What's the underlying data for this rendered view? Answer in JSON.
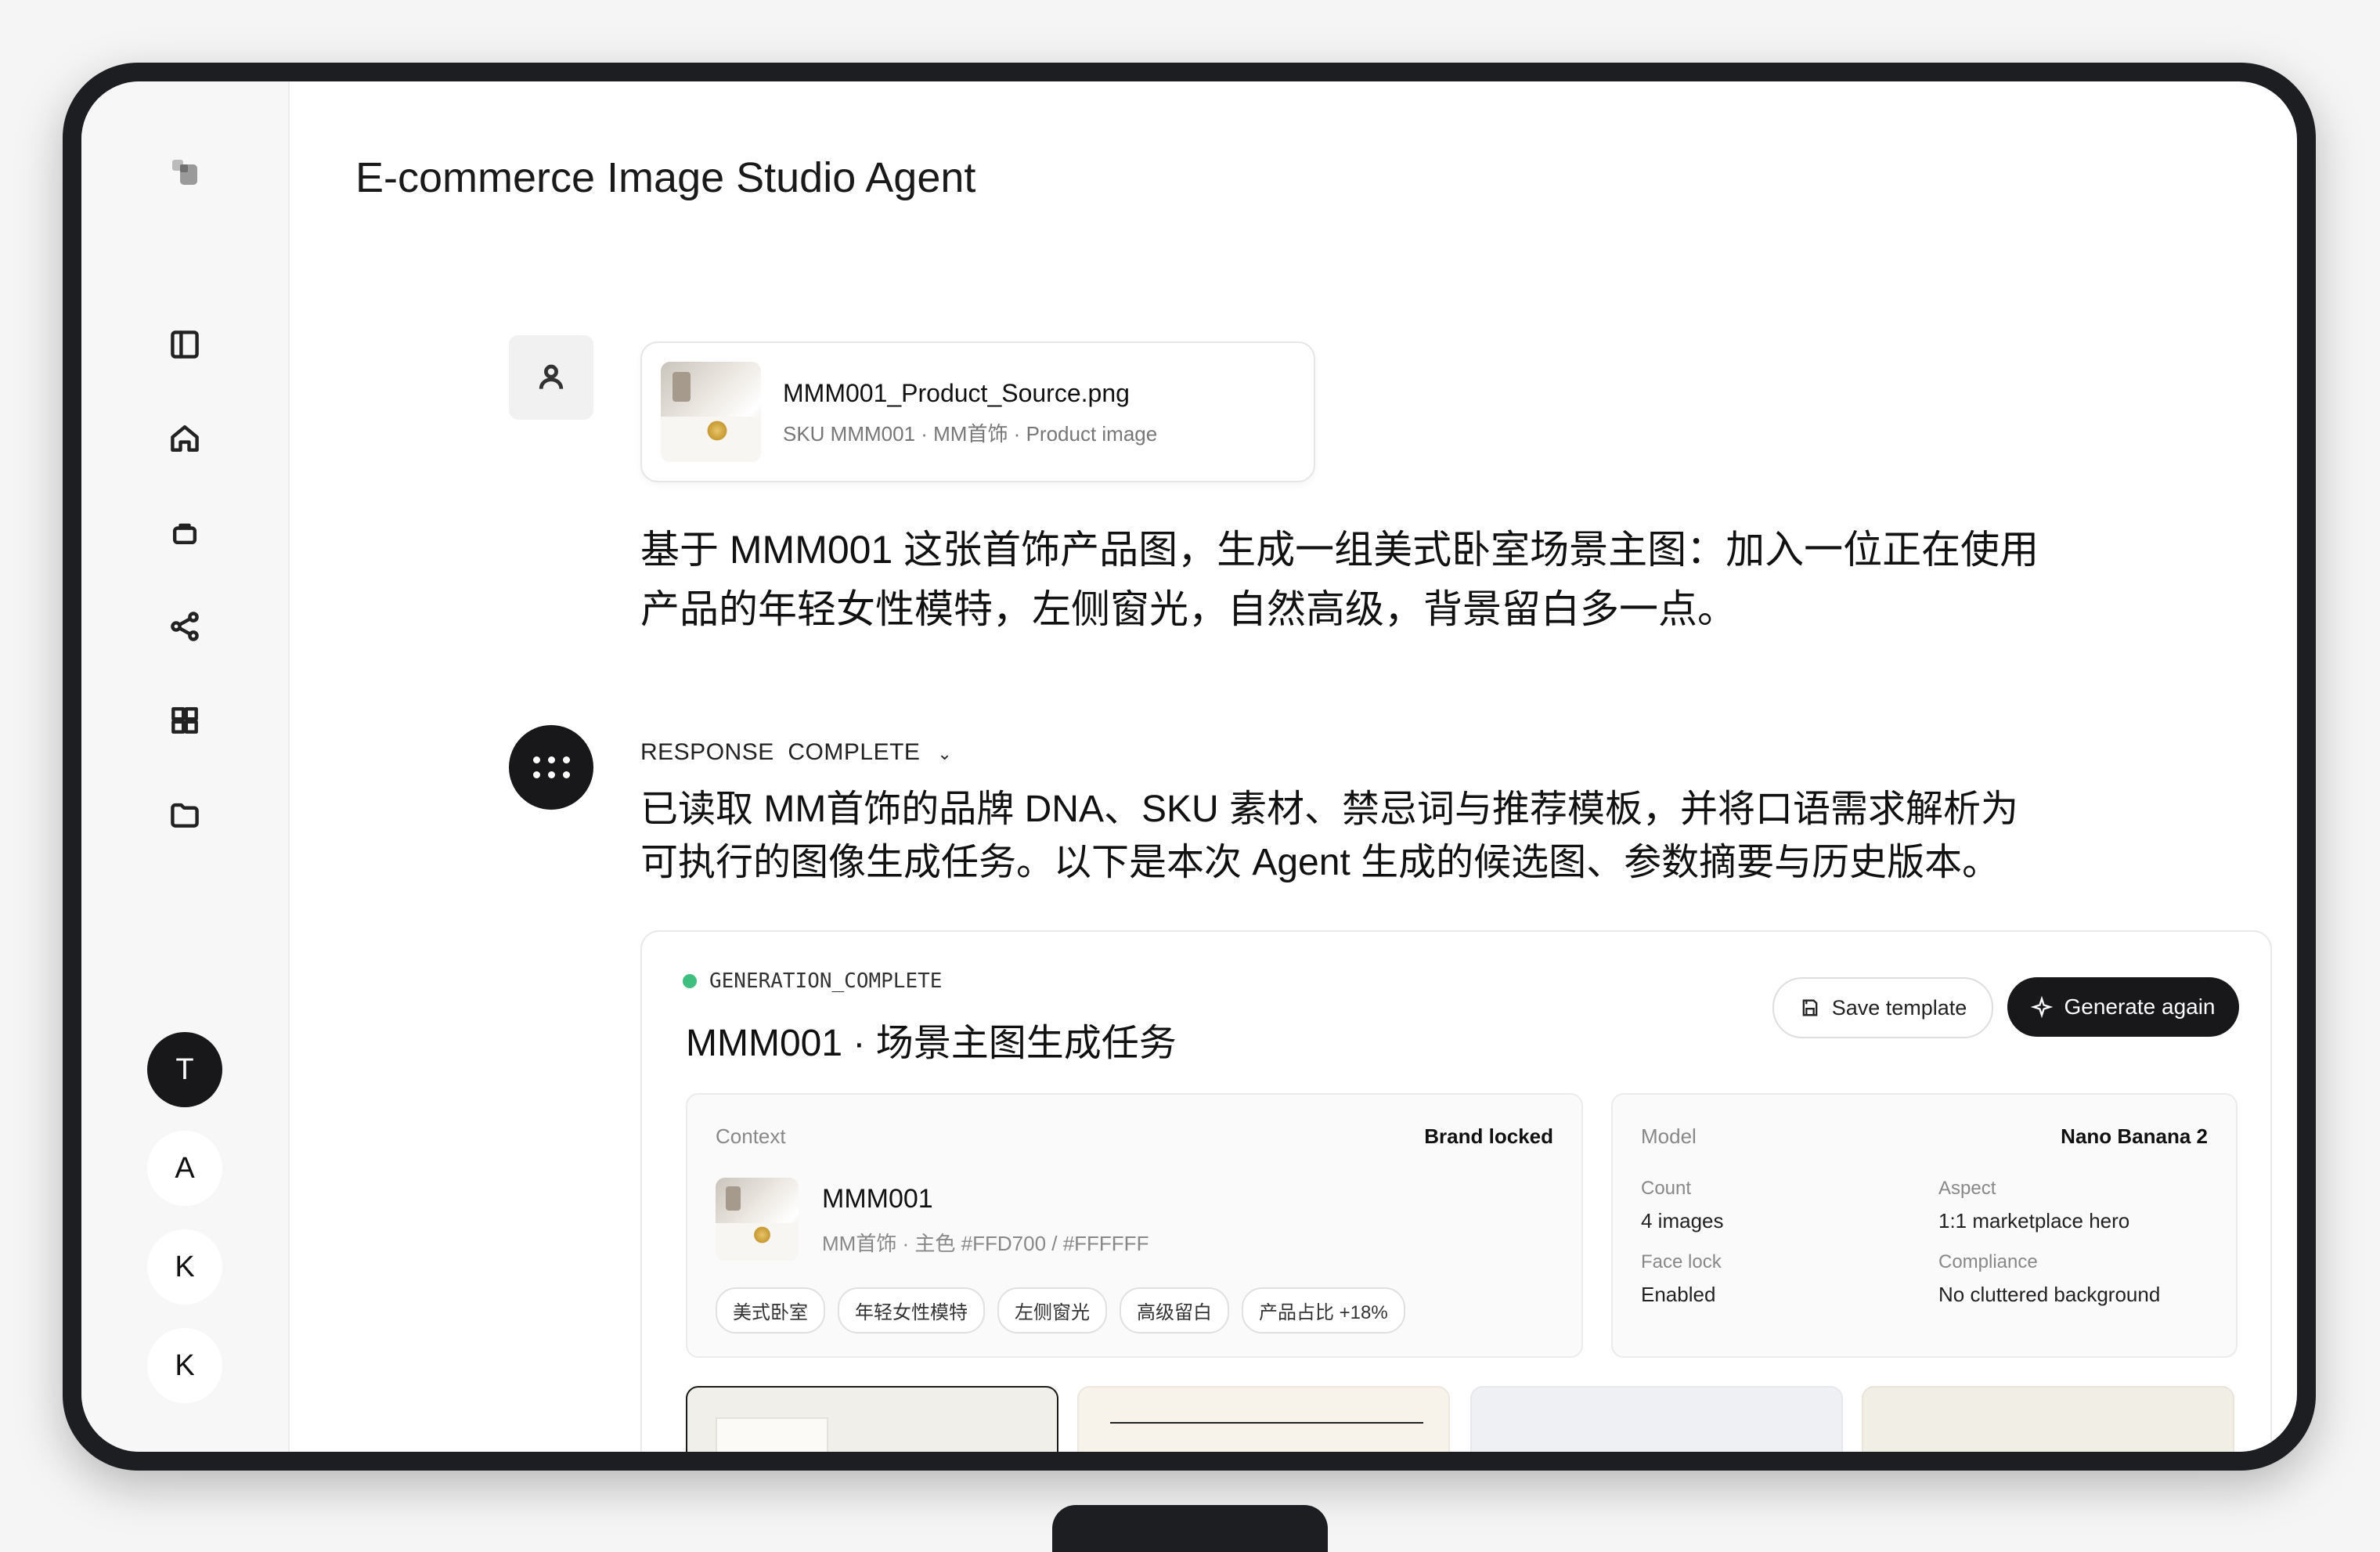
{
  "app": {
    "title": "E-commerce Image Studio Agent"
  },
  "sidebar": {
    "avatars": [
      {
        "letter": "T"
      },
      {
        "letter": "A"
      },
      {
        "letter": "K"
      },
      {
        "letter": "K"
      }
    ]
  },
  "user_message": {
    "file": {
      "name": "MMM001_Product_Source.png",
      "meta": "SKU MMM001 · MM首饰 · Product image"
    },
    "prompt": "基于 MMM001 这张首饰产品图，生成一组美式卧室场景主图：加入一位正在使用产品的年轻女性模特，左侧窗光，自然高级，背景留白多一点。"
  },
  "agent_response": {
    "status": "RESPONSE  COMPLETE",
    "text": "已读取 MM首饰的品牌 DNA、SKU 素材、禁忌词与推荐模板，并将口语需求解析为可执行的图像生成任务。以下是本次 Agent 生成的候选图、参数摘要与历史版本。"
  },
  "task": {
    "status": "GENERATION_COMPLETE",
    "title": "MMM001 · 场景主图生成任务",
    "save_label": "Save template",
    "generate_label": "Generate again",
    "context": {
      "label": "Context",
      "badge": "Brand locked",
      "sku": "MMM001",
      "meta": "MM首饰 · 主色 #FFD700 / #FFFFFF",
      "tags": [
        "美式卧室",
        "年轻女性模特",
        "左侧窗光",
        "高级留白",
        "产品占比 +18%"
      ]
    },
    "model": {
      "label": "Model",
      "name": "Nano Banana 2",
      "count_label": "Count",
      "count": "4 images",
      "aspect_label": "Aspect",
      "aspect": "1:1 marketplace hero",
      "face_label": "Face lock",
      "face": "Enabled",
      "compliance_label": "Compliance",
      "compliance": "No cluttered background"
    }
  },
  "icons": {
    "nav": [
      "sidebar-toggle-icon",
      "home-icon",
      "briefcase-icon",
      "share-icon",
      "grid-icon",
      "folder-icon"
    ]
  }
}
